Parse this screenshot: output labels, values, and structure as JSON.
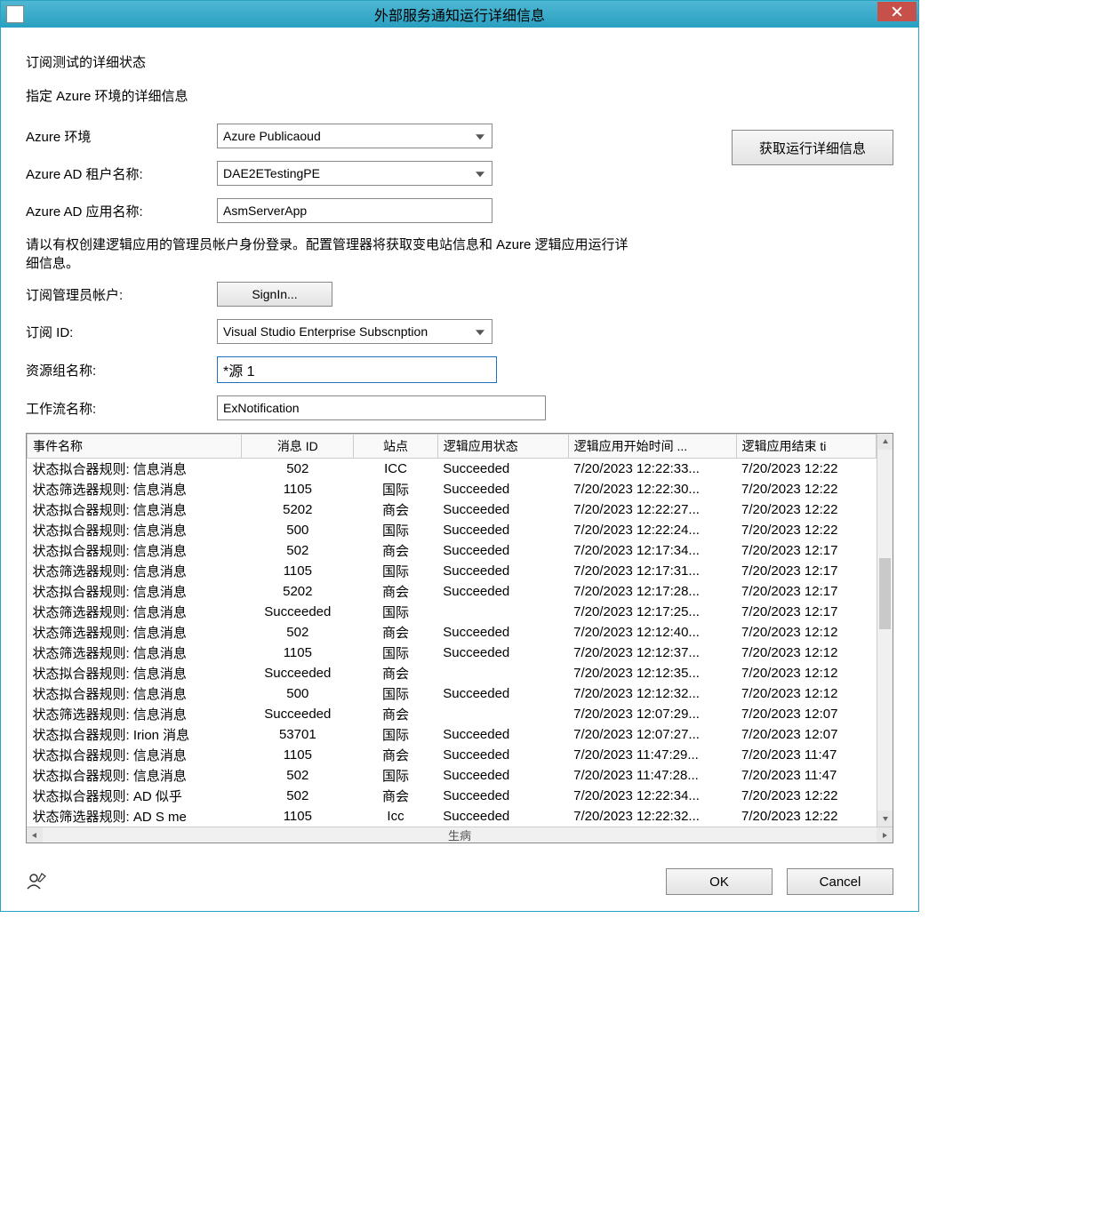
{
  "window": {
    "title": "外部服务通知运行详细信息"
  },
  "header": {
    "status_title": "订阅测试的详细状态",
    "instruct1": "指定 Azure 环境的详细信息",
    "get_run_label": "获取运行详细信息"
  },
  "form": {
    "env_label": "Azure 环境",
    "env_value": "Azure Publicaoud",
    "tenant_label": "Azure AD 租户名称:",
    "tenant_value": "DAE2ETestingPE",
    "app_label": "Azure AD 应用名称:",
    "app_value": "AsmServerApp",
    "signin_instruct": "请以有权创建逻辑应用的管理员帐户身份登录。配置管理器将获取变电站信息和 Azure 逻辑应用运行详细信息。",
    "admin_label": "订阅管理员帐户:",
    "signin_btn": "SignIn...",
    "sub_label": "订阅 ID:",
    "sub_value": "Visual Studio Enterprise Subscnption",
    "rg_label": "资源组名称:",
    "rg_value": "*源 1",
    "wf_label": "工作流名称:",
    "wf_value": "ExNotification"
  },
  "table": {
    "headers": {
      "c0": "事件名称",
      "c1": "消息 ID",
      "c2": "站点",
      "c3": "逻辑应用状态",
      "c4": "逻辑应用开始时间 ...",
      "c5": "逻辑应用结束 ti"
    },
    "rows": [
      {
        "c0": "状态拟合器规则: 信息消息",
        "c1": "502",
        "c2": "ICC",
        "c3": "Succeeded",
        "c4": "7/20/2023 12:22:33...",
        "c5": "7/20/2023 12:22"
      },
      {
        "c0": "状态筛选器规则: 信息消息",
        "c1": "1105",
        "c2": "国际",
        "c3": "Succeeded",
        "c4": "7/20/2023 12:22:30...",
        "c5": "7/20/2023 12:22"
      },
      {
        "c0": "状态拟合器规则: 信息消息",
        "c1": "5202",
        "c2": "商会",
        "c3": "Succeeded",
        "c4": "7/20/2023 12:22:27...",
        "c5": "7/20/2023 12:22"
      },
      {
        "c0": "状态拟合器规则: 信息消息",
        "c1": "500",
        "c2": "国际",
        "c3": "Succeeded",
        "c4": "7/20/2023 12:22:24...",
        "c5": "7/20/2023 12:22"
      },
      {
        "c0": "状态拟合器规则: 信息消息",
        "c1": "502",
        "c2": "商会",
        "c3": "Succeeded",
        "c4": "7/20/2023 12:17:34...",
        "c5": "7/20/2023 12:17"
      },
      {
        "c0": "状态筛选器规则: 信息消息",
        "c1": "1105",
        "c2": "国际",
        "c3": "Succeeded",
        "c4": "7/20/2023 12:17:31...",
        "c5": "7/20/2023 12:17"
      },
      {
        "c0": "状态拟合器规则: 信息消息",
        "c1": "5202",
        "c2": "商会",
        "c3": "Succeeded",
        "c4": "7/20/2023 12:17:28...",
        "c5": "7/20/2023 12:17"
      },
      {
        "c0": "状态筛选器规则: 信息消息",
        "c1": "Succeeded",
        "c2": "国际",
        "c3": "",
        "c4": "7/20/2023 12:17:25...",
        "c5": "7/20/2023 12:17"
      },
      {
        "c0": "状态筛选器规则: 信息消息",
        "c1": "502",
        "c2": "商会",
        "c3": "Succeeded",
        "c4": "7/20/2023 12:12:40...",
        "c5": "7/20/2023 12:12"
      },
      {
        "c0": "状态筛选器规则: 信息消息",
        "c1": "1105",
        "c2": "国际",
        "c3": "Succeeded",
        "c4": "7/20/2023 12:12:37...",
        "c5": "7/20/2023 12:12"
      },
      {
        "c0": "状态拟合器规则: 信息消息",
        "c1": "Succeeded",
        "c2": "商会",
        "c3": "",
        "c4": "7/20/2023 12:12:35...",
        "c5": "7/20/2023 12:12"
      },
      {
        "c0": "状态拟合器规则: 信息消息",
        "c1": "500",
        "c2": "国际",
        "c3": "Succeeded",
        "c4": "7/20/2023 12:12:32...",
        "c5": "7/20/2023 12:12"
      },
      {
        "c0": "状态筛选器规则: 信息消息",
        "c1": "Succeeded",
        "c2": "商会",
        "c3": "",
        "c4": "7/20/2023 12:07:29...",
        "c5": "7/20/2023 12:07"
      },
      {
        "c0": "状态拟合器规则: Irion 消息",
        "c1": "53701",
        "c2": "国际",
        "c3": "Succeeded",
        "c4": "7/20/2023 12:07:27...",
        "c5": "7/20/2023 12:07"
      },
      {
        "c0": "状态拟合器规则: 信息消息",
        "c1": "1105",
        "c2": "商会",
        "c3": "Succeeded",
        "c4": "7/20/2023 11:47:29...",
        "c5": "7/20/2023 11:47"
      },
      {
        "c0": "状态拟合器规则: 信息消息",
        "c1": "502",
        "c2": "国际",
        "c3": "Succeeded",
        "c4": "7/20/2023 11:47:28...",
        "c5": "7/20/2023 11:47"
      },
      {
        "c0": "状态拟合器规则: AD 似乎",
        "c1": "502",
        "c2": "商会",
        "c3": "Succeeded",
        "c4": "7/20/2023 12:22:34...",
        "c5": "7/20/2023 12:22"
      },
      {
        "c0": "状态筛选器规则: AD S me",
        "c1": "1105",
        "c2": "Icc",
        "c3": "Succeeded",
        "c4": "7/20/2023 12:22:32...",
        "c5": "7/20/2023 12:22"
      }
    ],
    "hscroll_label": "生病"
  },
  "footer": {
    "ok": "OK",
    "cancel": "Cancel"
  }
}
